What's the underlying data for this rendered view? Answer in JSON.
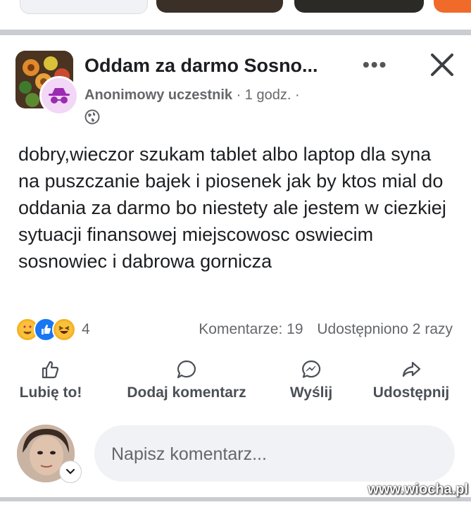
{
  "post": {
    "group_name": "Oddam za darmo Sosno...",
    "author": "Anonimowy uczestnik",
    "time": "· 1 godz. ·",
    "text": "dobry,wieczor szukam tablet albo laptop dla syna na puszczanie bajek i piosenek jak by ktos mial do oddania za darmo bo niestety ale jestem w ciezkiej sytuacji finansowej miejscowosc oswiecim sosnowiec i dabrowa gornicza",
    "more_label": "•••",
    "reactions": {
      "icons": [
        "heart-eyes-emoji",
        "like-icon",
        "laughing-emoji"
      ],
      "count": "4"
    },
    "comments_count": "Komentarze: 19",
    "shares_count": "Udostępniono 2 razy"
  },
  "actions": {
    "like": "Lubię to!",
    "comment": "Dodaj komentarz",
    "send": "Wyślij",
    "share": "Udostępnij"
  },
  "comment_input": {
    "placeholder": "Napisz komentarz..."
  },
  "watermark": "www.wiocha.pl",
  "colors": {
    "text_primary": "#1c1e21",
    "text_secondary": "#65676b",
    "divider": "#c9ccd1",
    "input_bg": "#f0f2f5",
    "like_blue": "#1877f2"
  }
}
